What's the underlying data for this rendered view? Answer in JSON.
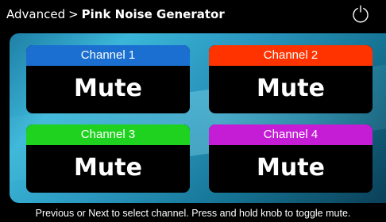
{
  "header": {
    "parent": "Advanced",
    "separator": ">",
    "current": "Pink Noise Generator",
    "power_icon": "power-icon"
  },
  "channels": [
    {
      "label": "Channel 1",
      "state": "Mute",
      "color": "#1a6fd0"
    },
    {
      "label": "Channel 2",
      "state": "Mute",
      "color": "#ff3300"
    },
    {
      "label": "Channel 3",
      "state": "Mute",
      "color": "#1fd21f"
    },
    {
      "label": "Channel 4",
      "state": "Mute",
      "color": "#c51dd6"
    }
  ],
  "footer": {
    "instructions": "Previous or Next to select channel. Press and hold knob to toggle mute."
  }
}
